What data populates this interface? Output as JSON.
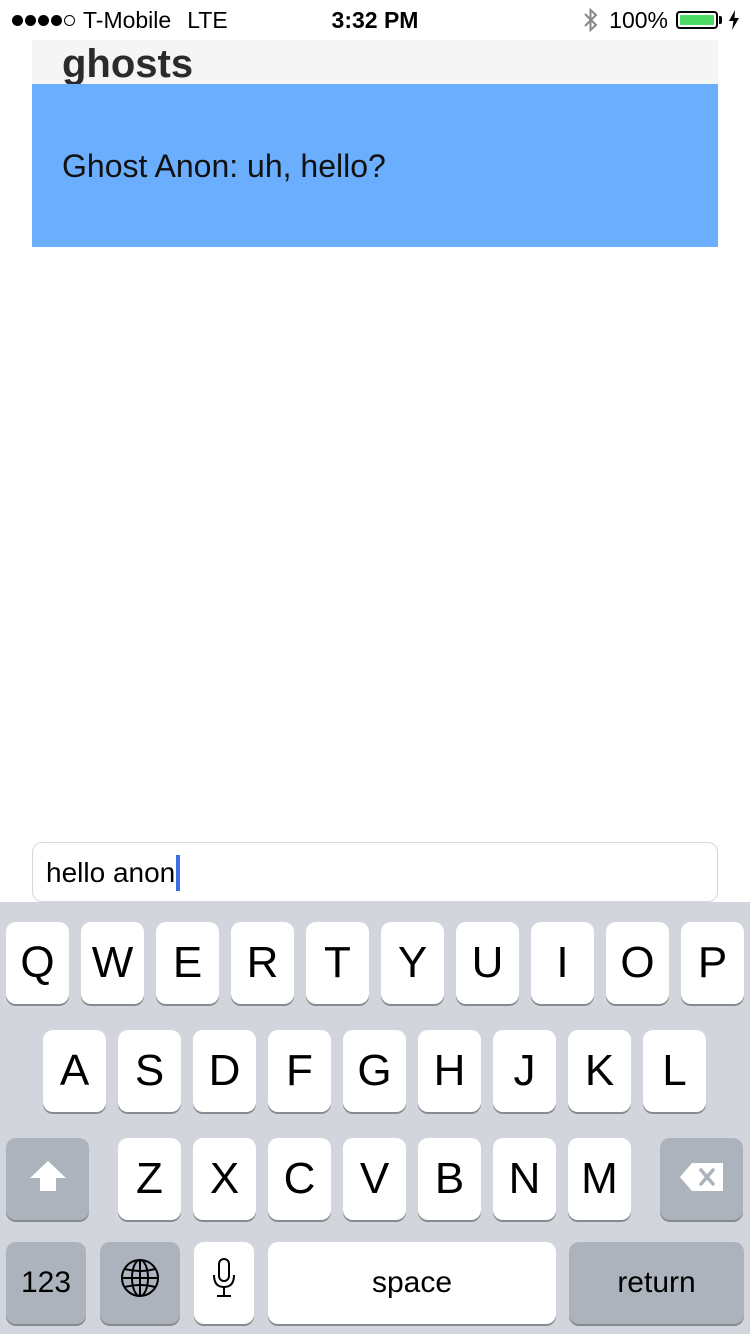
{
  "status_bar": {
    "carrier": "T-Mobile",
    "network": "LTE",
    "time": "3:32 PM",
    "battery_percent": "100%",
    "signal_bars": 4,
    "signal_max": 5,
    "icons": [
      "signal-dots-icon",
      "bluetooth-icon",
      "battery-icon",
      "charging-bolt-icon"
    ]
  },
  "app": {
    "title": "ghosts",
    "messages": [
      {
        "text": "Ghost Anon: uh, hello?"
      }
    ],
    "input": {
      "value": "hello anon"
    },
    "colors": {
      "message_bg": "#6aaefd",
      "header_bg": "#f5f5f5",
      "caret": "#3d6de4"
    }
  },
  "keyboard": {
    "row1": [
      "Q",
      "W",
      "E",
      "R",
      "T",
      "Y",
      "U",
      "I",
      "O",
      "P"
    ],
    "row2": [
      "A",
      "S",
      "D",
      "F",
      "G",
      "H",
      "J",
      "K",
      "L"
    ],
    "row3": [
      "Z",
      "X",
      "C",
      "V",
      "B",
      "N",
      "M"
    ],
    "numbers_label": "123",
    "space_label": "space",
    "return_label": "return",
    "icons": [
      "shift-icon",
      "backspace-icon",
      "globe-icon",
      "microphone-icon"
    ]
  }
}
